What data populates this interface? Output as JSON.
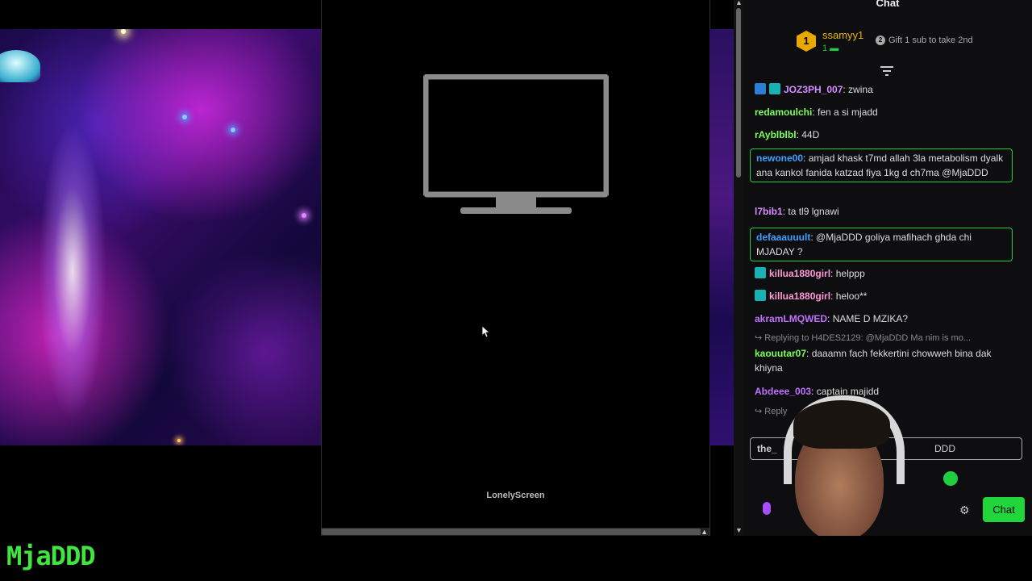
{
  "center_window": {
    "label": "LonelyScreen"
  },
  "chat": {
    "title": "Chat",
    "leaderboard": {
      "rank": "1",
      "name": "ssamyy1",
      "count": "1",
      "gift_text": "Gift 1 sub to take 2nd",
      "gift_badge": "2"
    },
    "messages": [
      {
        "user": "JOZ3PH_007",
        "text": ": zwina",
        "color": "#d68cff",
        "badges": [
          "blue",
          "teal"
        ],
        "highlight": false
      },
      {
        "user": "redamoulchi",
        "text": ": fen a si mjadd",
        "color": "#7cff5a",
        "badges": [],
        "highlight": false
      },
      {
        "user": "rAyblblbl",
        "text": ": 44D",
        "color": "#7cff5a",
        "badges": [],
        "highlight": false
      },
      {
        "user": "newone00",
        "text": ": amjad khask t7md allah 3la metabolism dyalk ana kankol fanida katzad fiya 1kg d ch7ma @MjaDDD",
        "color": "#3da0ff",
        "badges": [],
        "highlight": true
      },
      {
        "user": "l7bib1",
        "text": ": ta tl9 lgnawi",
        "color": "#d68cff",
        "badges": [],
        "highlight": false
      },
      {
        "user": "defaaauuult",
        "text": ": @MjaDDD goliya mafihach ghda chi MJADAY ?",
        "color": "#3da0ff",
        "badges": [],
        "highlight": true
      },
      {
        "user": "killua1880girl",
        "text": ": helppp",
        "color": "#ff9ad6",
        "badges": [
          "teal"
        ],
        "highlight": false
      },
      {
        "user": "killua1880girl",
        "text": ": heloo**",
        "color": "#ff9ad6",
        "badges": [
          "teal"
        ],
        "highlight": false
      },
      {
        "user": "akramLMQWED",
        "text": ": NAME D MZIKA?",
        "color": "#c070ff",
        "badges": [],
        "highlight": false
      },
      {
        "user": "kaouutar07",
        "text": ": daaamn fach fekkertini chowweh bina dak khiyna",
        "color": "#7cff5a",
        "badges": [],
        "highlight": false
      },
      {
        "user": "Abdeee_003",
        "text": ": captain majidd",
        "color": "#c070ff",
        "badges": [],
        "highlight": false
      }
    ],
    "reply_line": "Replying to H4DES2129: @MjaDDD Ma nim is mo...",
    "reply_line_2": "Reply",
    "input_prefix": "the_",
    "input_suffix": "DDD",
    "chat_button": "Chat"
  },
  "streamer_name": "MjaDDD",
  "colors": {
    "accent": "#20d63a",
    "gold": "#e8b400"
  }
}
